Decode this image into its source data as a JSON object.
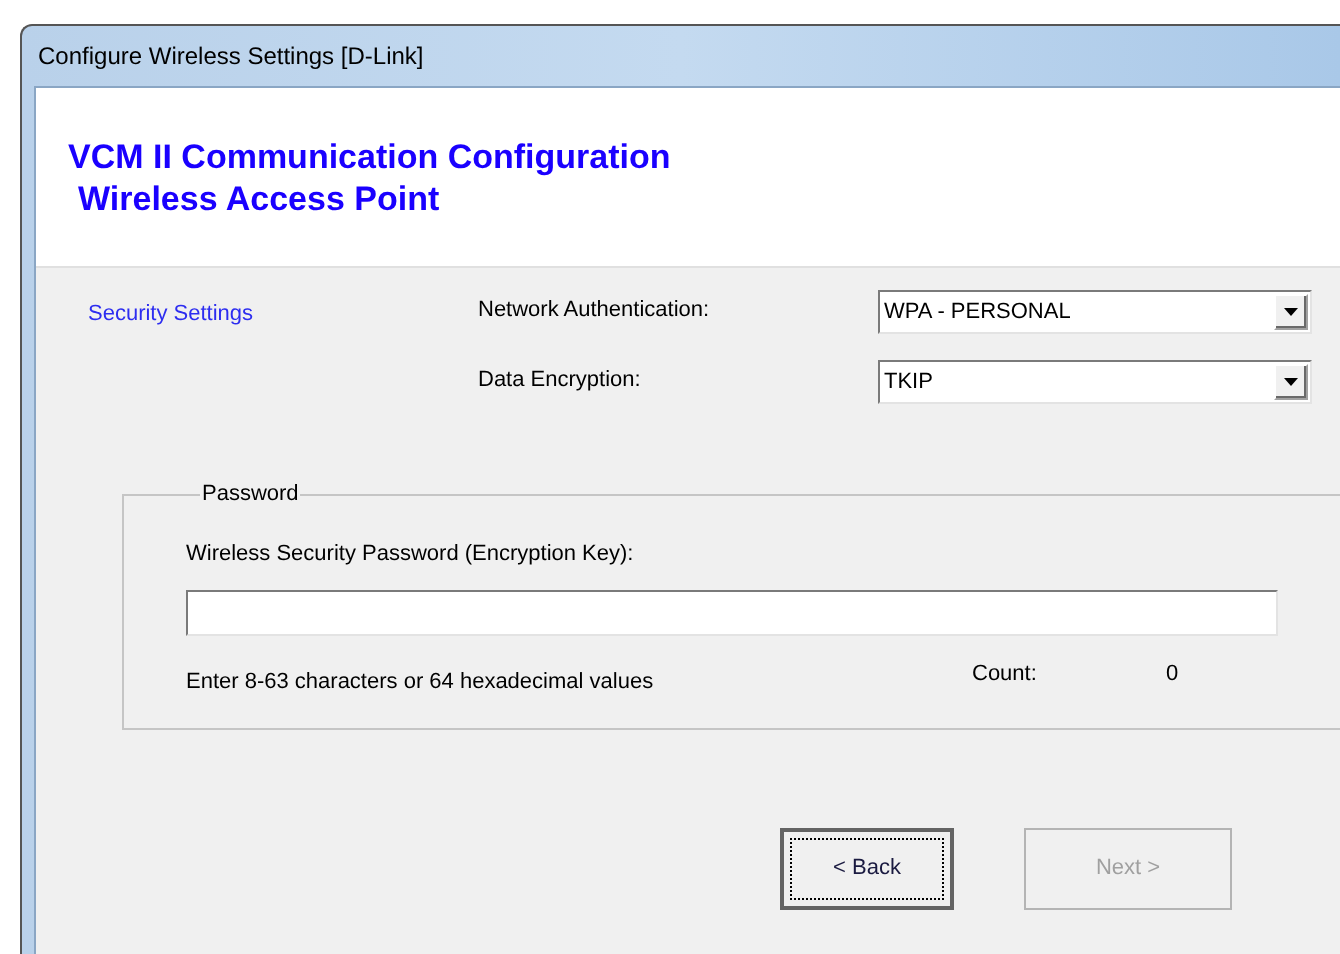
{
  "window": {
    "title": "Configure Wireless Settings [D-Link]"
  },
  "header": {
    "title": "VCM II Communication Configuration",
    "subtitle": "Wireless Access Point"
  },
  "section": {
    "label": "Security Settings"
  },
  "fields": [
    {
      "label": "Network Authentication:",
      "value": "WPA - PERSONAL"
    },
    {
      "label": "Data Encryption:",
      "value": "TKIP"
    }
  ],
  "password_group": {
    "legend": "Password",
    "label": "Wireless Security Password (Encryption Key):",
    "hint": "Enter 8-63 characters or 64 hexadecimal values",
    "count_label": "Count:",
    "count": "0"
  },
  "buttons": [
    {
      "label": "< Back",
      "disabled": false,
      "focused": true
    },
    {
      "label": "Next >",
      "disabled": true,
      "focused": false
    }
  ]
}
